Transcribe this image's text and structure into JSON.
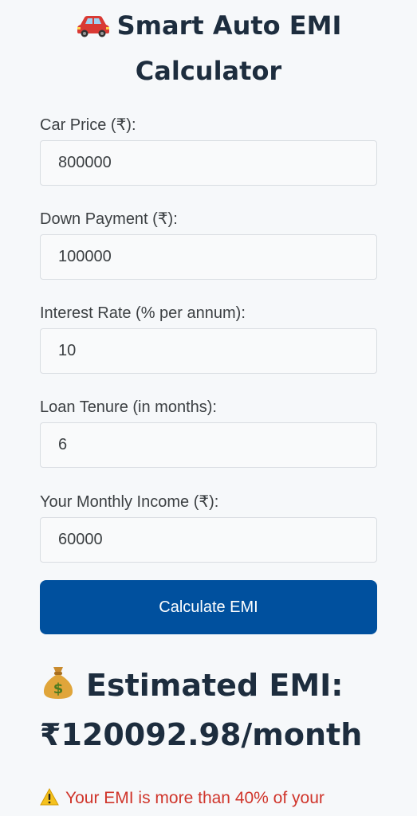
{
  "header": {
    "icon": "car-icon",
    "title": "Smart Auto EMI Calculator"
  },
  "form": {
    "fields": [
      {
        "label": "Car Price (₹):",
        "value": "800000"
      },
      {
        "label": "Down Payment (₹):",
        "value": "100000"
      },
      {
        "label": "Interest Rate (% per annum):",
        "value": "10"
      },
      {
        "label": "Loan Tenure (in months):",
        "value": "6"
      },
      {
        "label": "Your Monthly Income (₹):",
        "value": "60000"
      }
    ],
    "submit_label": "Calculate EMI"
  },
  "result": {
    "icon": "money-bag-icon",
    "title": "Estimated EMI:",
    "value": "₹120092.98/month"
  },
  "warning": {
    "icon": "warning-icon",
    "text": "Your EMI is more than 40% of your"
  },
  "colors": {
    "primary_button": "#00509e",
    "heading": "#1d2d3e",
    "warning_text": "#d0352b",
    "background": "#f6f8fa"
  }
}
